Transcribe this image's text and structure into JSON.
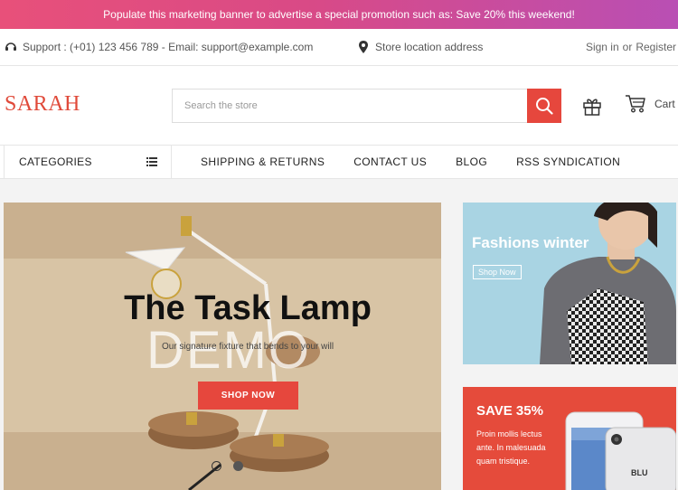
{
  "promo": {
    "text": "Populate this marketing banner to advertise a special promotion such as: Save 20% this weekend!"
  },
  "topbar": {
    "support": "Support : (+01) 123 456 789 - Email: support@example.com",
    "location": "Store location address",
    "signin": "Sign in",
    "or": "or",
    "register": "Register"
  },
  "header": {
    "logo": "SARAH",
    "search_placeholder": "Search the store",
    "cart_label": "Cart"
  },
  "nav": {
    "categories": "CATEGORIES",
    "items": [
      "SHIPPING & RETURNS",
      "CONTACT US",
      "BLOG",
      "RSS SYNDICATION"
    ]
  },
  "hero": {
    "title": "The Task Lamp",
    "watermark": "DEMO",
    "subtitle": "Our signature fixture that bends to your will",
    "button": "SHOP NOW"
  },
  "banner_fashion": {
    "title": "Fashions winter",
    "button": "Shop Now"
  },
  "banner_phone": {
    "title": "SAVE 35%",
    "text": "Proin mollis lectus ante. In malesuada quam tristique.",
    "brand": "BLU"
  },
  "colors": {
    "accent": "#e6473d",
    "promo_start": "#e8507a",
    "promo_end": "#b94fb4"
  },
  "icons": [
    "support-icon",
    "location-pin-icon",
    "search-icon",
    "gift-icon",
    "cart-icon",
    "list-icon"
  ]
}
